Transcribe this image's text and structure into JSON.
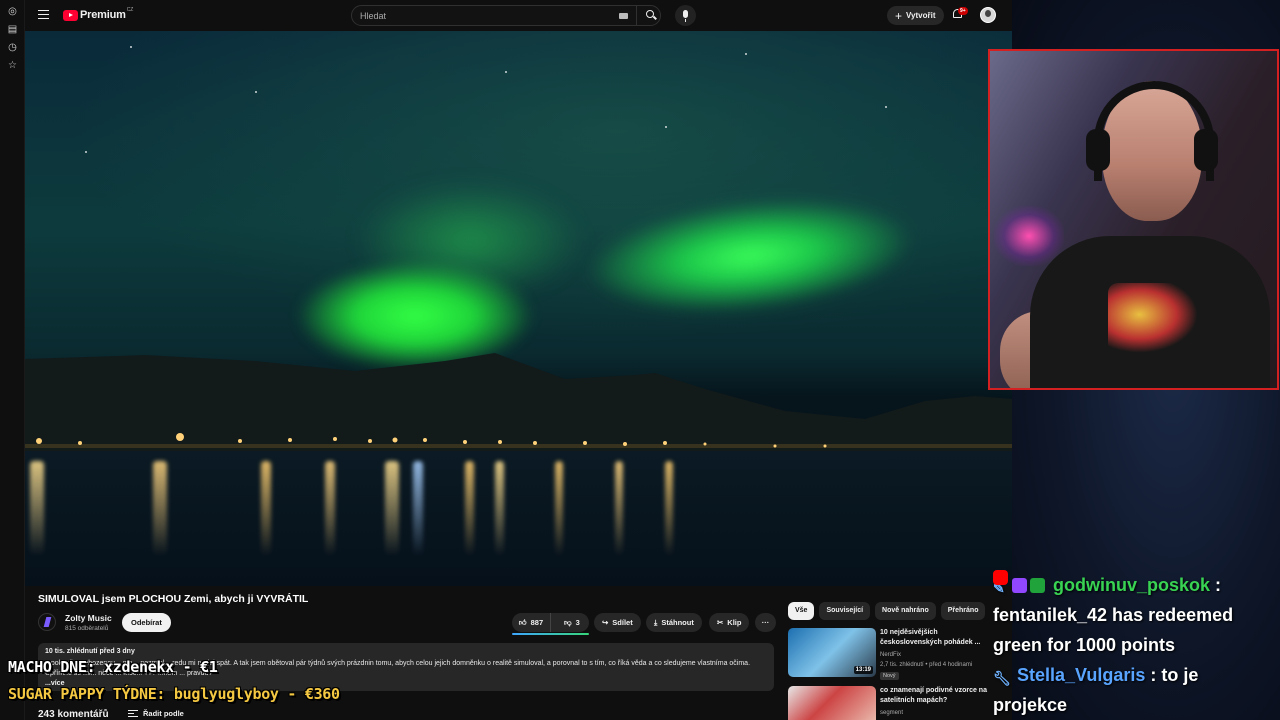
{
  "youtube": {
    "logo_text": "Premium",
    "logo_country": "CZ",
    "search_placeholder": "Hledat",
    "create_label": "Vytvořit",
    "notif_count": "9+",
    "video": {
      "title": "SIMULOVAL jsem PLOCHOU Zemi, abych ji VYVRÁTIL",
      "channel": "Zolty Music",
      "subscribers": "815 odběratelů",
      "subscribe_label": "Odebírat",
      "likes": "887",
      "dislikes": "3",
      "share_label": "Sdílet",
      "download_label": "Stáhnout",
      "clip_label": "Klip",
      "more_label": "···",
      "description_meta": "10 tis. zhlédnutí  před 3 dny",
      "description_text": "...pokusil... nahozenou... ma... nezmiel... redu mi nedal spát. A tak jsem obětoval pár týdnů svých prázdnin tomu, abych celou jejich domněnku o realitě simuloval, a porovnal to s tím, co říká věda a co sledujeme vlastníma očima. Upřímně se mi... něco ... Moc... ??? ...něm ... pravdu?",
      "more_link": "...více",
      "comments_count": "243 komentářů",
      "sort_label": "Řadit podle"
    },
    "chips": [
      "Vše",
      "Související",
      "Nově nahráno",
      "Přehráno"
    ],
    "recommendations": [
      {
        "title": "10 nejděsivějších československých pohádek ...",
        "channel": "NerdFix",
        "meta": "2,7 tis. zhlédnutí  •  před 4 hodinami",
        "badge": "Nový",
        "duration": "13:19"
      },
      {
        "title": "co znamenají podivné vzorce na satelitních mapách?",
        "channel": "segment",
        "meta": "",
        "badge": "",
        "duration": ""
      }
    ]
  },
  "overlays": {
    "macho": "MACHO DNE: xzdenekx - €1",
    "sugar": "SUGAR PAPPY TÝDNE: buglyuglyboy - €360"
  },
  "chat": [
    {
      "user": "godwinuv_poskok",
      "separator": " :",
      "message": ""
    },
    {
      "user": "",
      "separator": "",
      "message": "fentanilek_42 has redeemed green for 1000 points"
    },
    {
      "user": "Stella_Vulgaris",
      "separator": " :",
      "message": " to je projekce"
    }
  ],
  "colors": {
    "yt_bg": "#0f0f0f",
    "cam_border": "#d42020",
    "chat_user_green": "#39d353",
    "chat_user_blue": "#59a4ff",
    "sugar_yellow": "#f5c842"
  }
}
